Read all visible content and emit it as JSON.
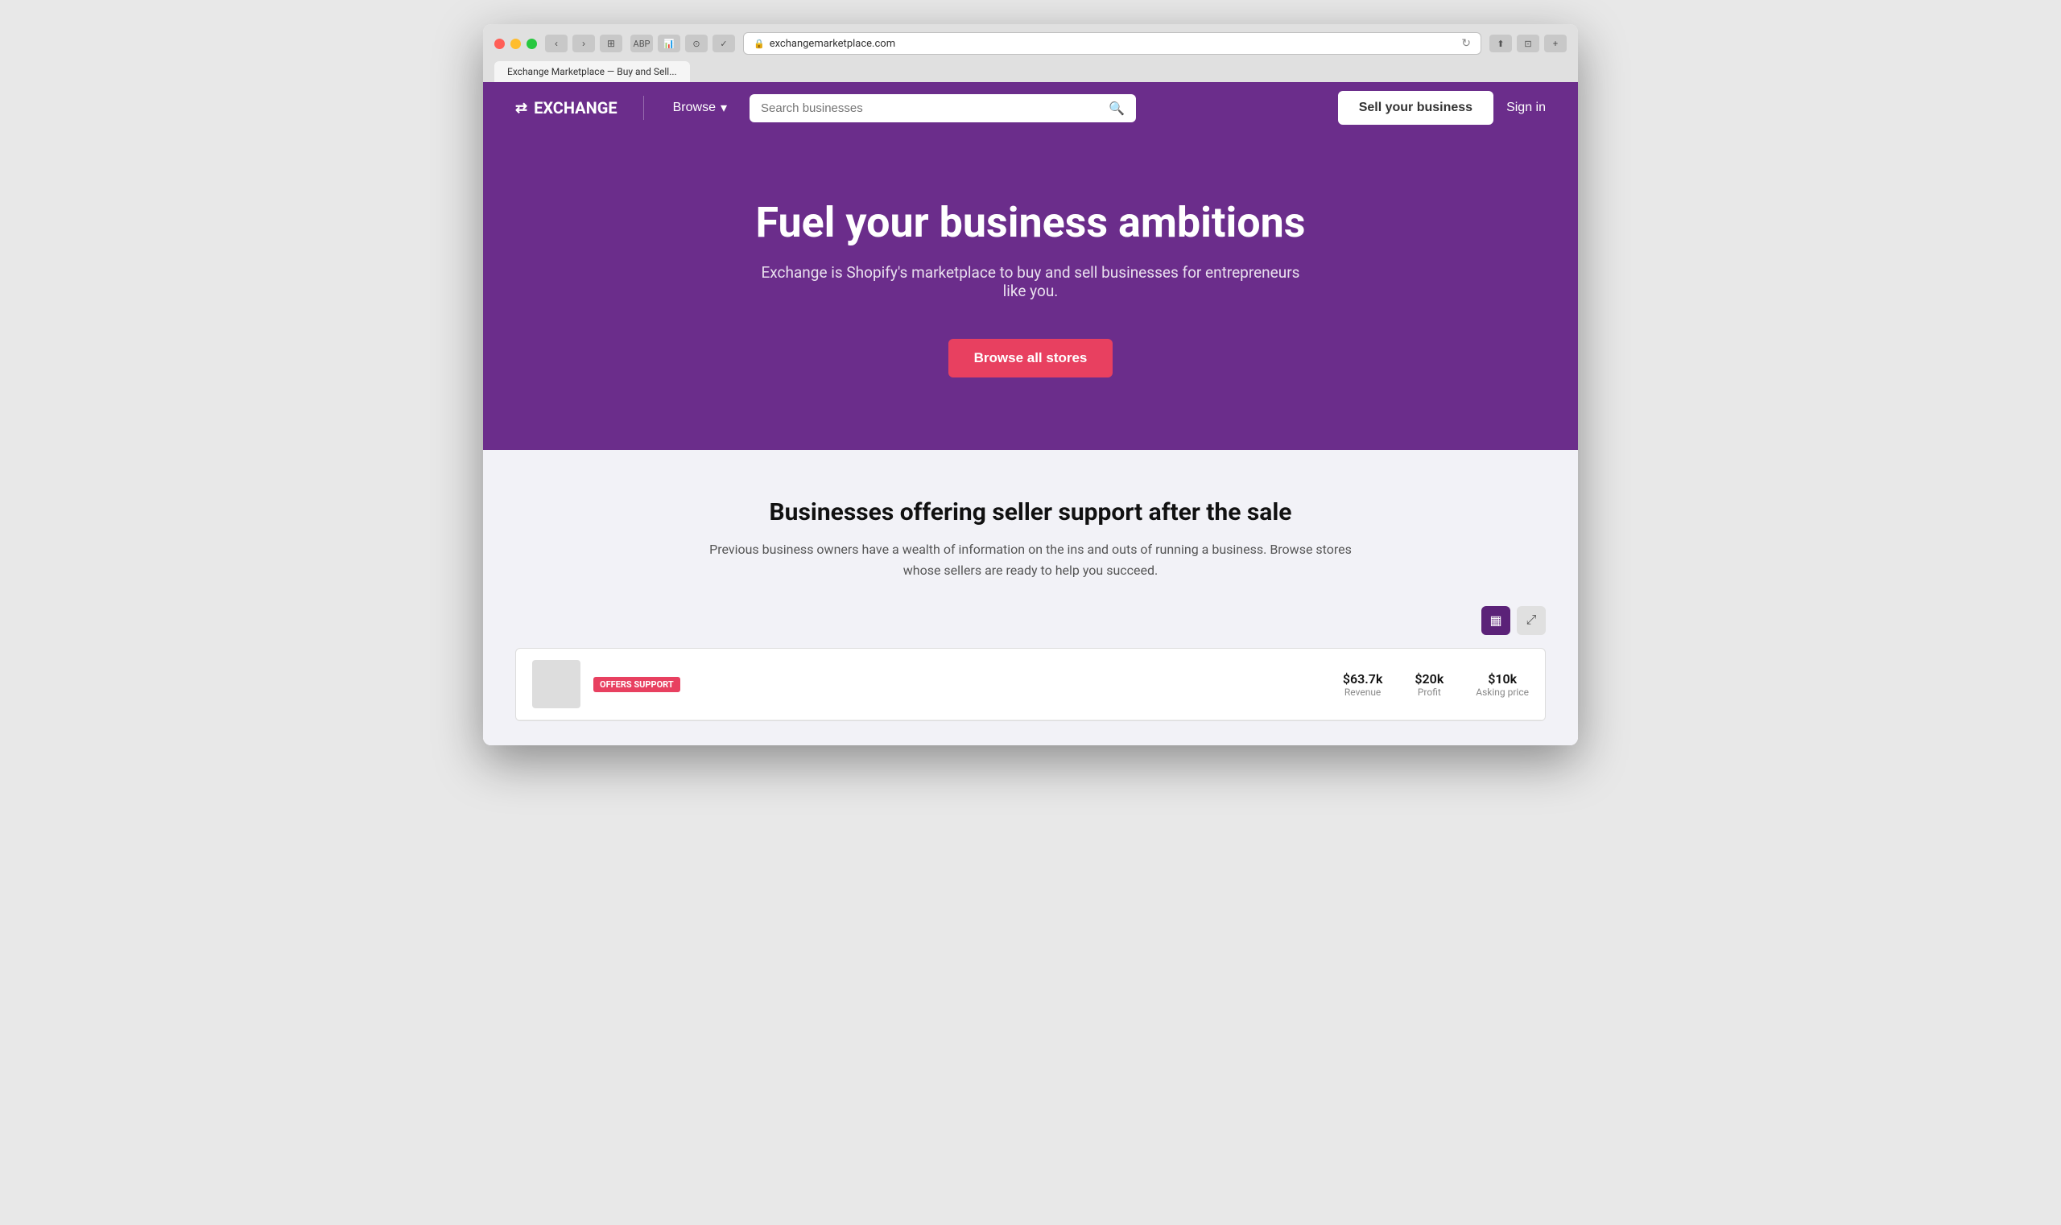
{
  "browser": {
    "url": "exchangemarketplace.com",
    "tab_label": "Exchange Marketplace — Buy and Sell...",
    "lock_icon": "🔒",
    "refresh_icon": "↻"
  },
  "navbar": {
    "logo_text": "EXCHANGE",
    "logo_icon": "⇄",
    "browse_label": "Browse",
    "browse_arrow": "▾",
    "search_placeholder": "Search businesses",
    "sell_button_label": "Sell your business",
    "sign_in_label": "Sign in"
  },
  "hero": {
    "title": "Fuel your business ambitions",
    "subtitle": "Exchange is Shopify's marketplace to buy and sell businesses for entrepreneurs like you.",
    "cta_label": "Browse all stores"
  },
  "section": {
    "title": "Businesses offering seller support after the sale",
    "subtitle": "Previous business owners have a wealth of information on the ins and outs of running a business. Browse stores whose sellers are ready to help you succeed.",
    "grid_icon": "▦",
    "list_icon": "⤢"
  },
  "listing_preview": {
    "badge": "OFFERS SUPPORT",
    "stat1_value": "$63.7k",
    "stat1_label": "Revenue",
    "stat2_value": "$20k",
    "stat2_label": "Profit",
    "stat3_value": "$10k",
    "stat3_label": "Asking price"
  }
}
